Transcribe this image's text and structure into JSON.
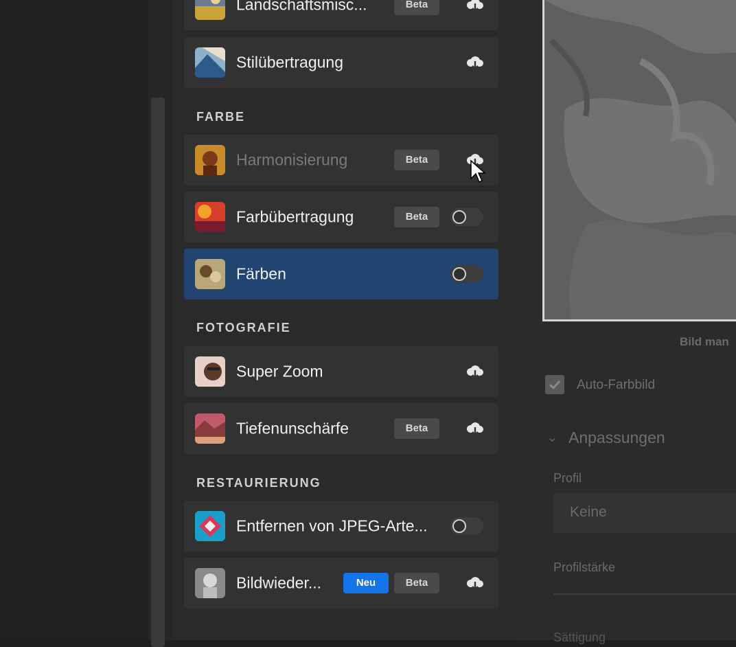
{
  "filters": {
    "top": [
      {
        "label": "Landschaftsmisc...",
        "badge": "Beta",
        "action": "download"
      },
      {
        "label": "Stilübertragung",
        "action": "download"
      }
    ],
    "farbe": {
      "title": "FARBE",
      "items": [
        {
          "label": "Harmonisierung",
          "badge": "Beta",
          "action": "download",
          "state": "hover"
        },
        {
          "label": "Farbübertragung",
          "badge": "Beta",
          "action": "toggle",
          "enabled": false
        },
        {
          "label": "Färben",
          "action": "toggle",
          "enabled": false,
          "selected": true
        }
      ]
    },
    "fotografie": {
      "title": "FOTOGRAFIE",
      "items": [
        {
          "label": "Super Zoom",
          "action": "download"
        },
        {
          "label": "Tiefenunschärfe",
          "badge": "Beta",
          "action": "download"
        }
      ]
    },
    "restaurierung": {
      "title": "RESTAURIERUNG",
      "items": [
        {
          "label": "Entfernen von JPEG-Arte...",
          "action": "toggle",
          "enabled": false
        },
        {
          "label": "Bildwieder...",
          "badge_new": "Neu",
          "badge": "Beta",
          "action": "download"
        }
      ]
    }
  },
  "options": {
    "preview_caption": "Bild man",
    "auto_color_label": "Auto-Farbbild",
    "auto_color_checked": true,
    "adjustments_title": "Anpassungen",
    "profile_label": "Profil",
    "profile_value": "Keine",
    "profile_strength_label": "Profilstärke",
    "saturation_label": "Sättigung"
  },
  "colors": {
    "selected_row": "#214570",
    "new_badge": "#1473e6"
  }
}
